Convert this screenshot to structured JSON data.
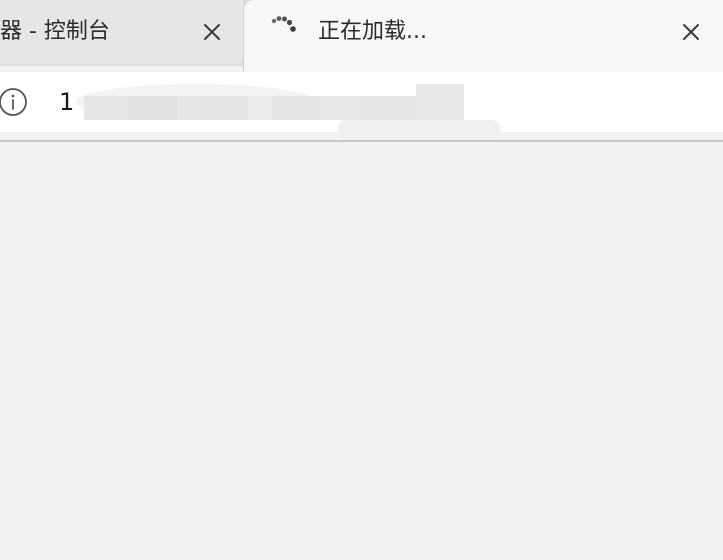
{
  "tabs": [
    {
      "title": "器 - 控制台",
      "active": false,
      "close_icon": "close-icon"
    },
    {
      "title": "正在加载...",
      "active": true,
      "loading": true,
      "close_icon": "close-icon"
    }
  ],
  "address_bar": {
    "site_info_icon": "info-icon",
    "url_text": "1"
  },
  "colors": {
    "tabstrip_bg": "#dfdfdf",
    "active_tab_bg": "#f7f7f7",
    "inactive_tab_bg": "#e6e6e6",
    "content_bg": "#f2f2f2"
  }
}
